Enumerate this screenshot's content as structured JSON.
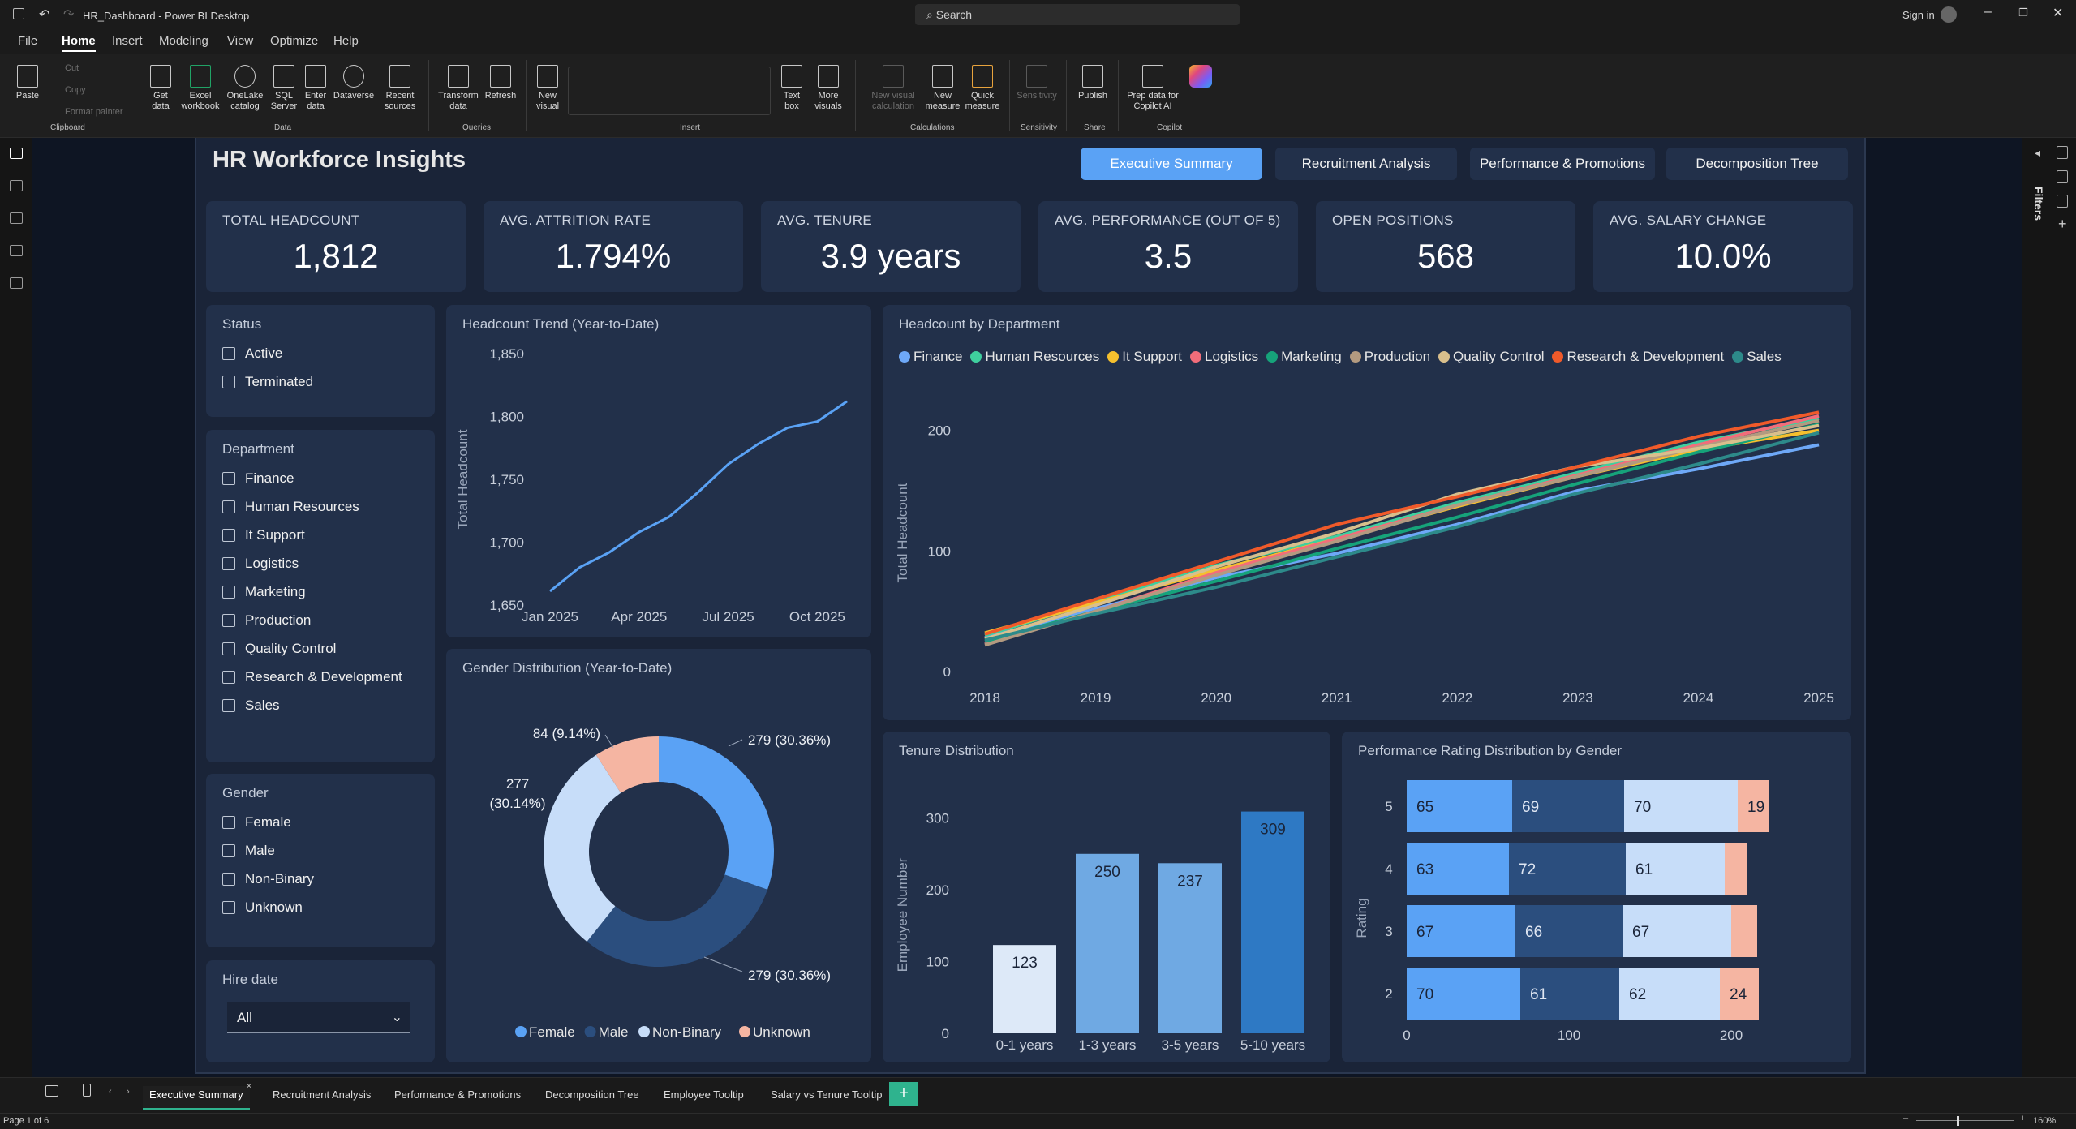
{
  "window": {
    "title": "HR_Dashboard - Power BI Desktop",
    "search_placeholder": "Search",
    "sign_in": "Sign in"
  },
  "menu": [
    "File",
    "Home",
    "Insert",
    "Modeling",
    "View",
    "Optimize",
    "Help"
  ],
  "ribbon": {
    "clipboard": {
      "paste": "Paste",
      "cut": "Cut",
      "copy": "Copy",
      "format_painter": "Format painter",
      "group": "Clipboard"
    },
    "data": {
      "get_data": "Get data",
      "excel": "Excel workbook",
      "onelake": "OneLake catalog",
      "sql": "SQL Server",
      "enter_data": "Enter data",
      "dataverse": "Dataverse",
      "recent": "Recent sources",
      "group": "Data"
    },
    "queries": {
      "transform": "Transform data",
      "refresh": "Refresh",
      "group": "Queries"
    },
    "insert": {
      "new_visual": "New visual",
      "text_box": "Text box",
      "more_visuals": "More visuals",
      "group": "Insert"
    },
    "calculations": {
      "new_visual_calc": "New visual calculation",
      "new_measure": "New measure",
      "quick_measure": "Quick measure",
      "group": "Calculations"
    },
    "sensitivity": {
      "label": "Sensitivity",
      "group": "Sensitivity"
    },
    "share": {
      "publish": "Publish",
      "group": "Share"
    },
    "copilot": {
      "prep": "Prep data for Copilot AI",
      "group": "Copilot"
    }
  },
  "report": {
    "title": "HR Workforce Insights",
    "nav": [
      "Executive Summary",
      "Recruitment Analysis",
      "Performance & Promotions",
      "Decomposition Tree"
    ],
    "kpis": [
      {
        "label": "TOTAL HEADCOUNT",
        "value": "1,812"
      },
      {
        "label": "AVG. ATTRITION RATE",
        "value": "1.794%"
      },
      {
        "label": "AVG. TENURE",
        "value": "3.9 years"
      },
      {
        "label": "AVG. PERFORMANCE (OUT OF 5)",
        "value": "3.5"
      },
      {
        "label": "OPEN POSITIONS",
        "value": "568"
      },
      {
        "label": "AVG. SALARY CHANGE",
        "value": "10.0%"
      }
    ],
    "slicers": {
      "status": {
        "title": "Status",
        "items": [
          "Active",
          "Terminated"
        ]
      },
      "department": {
        "title": "Department",
        "items": [
          "Finance",
          "Human Resources",
          "It Support",
          "Logistics",
          "Marketing",
          "Production",
          "Quality Control",
          "Research & Development",
          "Sales"
        ]
      },
      "gender": {
        "title": "Gender",
        "items": [
          "Female",
          "Male",
          "Non-Binary",
          "Unknown"
        ]
      },
      "hire_date": {
        "title": "Hire date",
        "value": "All"
      }
    }
  },
  "page_tabs": [
    "Executive Summary",
    "Recruitment Analysis",
    "Performance & Promotions",
    "Decomposition Tree",
    "Employee Tooltip",
    "Salary vs Tenure Tooltip"
  ],
  "status": {
    "page": "Page 1 of 6",
    "zoom": "160%"
  },
  "colors": {
    "accent": "#5aa2f5",
    "page_bg": "#1a2438",
    "card_bg": "#22304a"
  },
  "chart_data": [
    {
      "type": "line",
      "title": "Headcount Trend (Year-to-Date)",
      "ylabel": "Total Headcount",
      "x_ticks": [
        "Jan 2025",
        "Apr 2025",
        "Jul 2025",
        "Oct 2025"
      ],
      "ylim": [
        1650,
        1850
      ],
      "y_ticks": [
        "1,850",
        "1,800",
        "1,750",
        "1,700",
        "1,650"
      ],
      "x": [
        "Jan 2025",
        "Feb 2025",
        "Mar 2025",
        "Apr 2025",
        "May 2025",
        "Jun 2025",
        "Jul 2025",
        "Aug 2025",
        "Sep 2025",
        "Oct 2025",
        "Nov 2025"
      ],
      "values": [
        1661,
        1680,
        1692,
        1708,
        1720,
        1740,
        1762,
        1778,
        1791,
        1796,
        1812
      ],
      "color": "#5aa2f5"
    },
    {
      "type": "line",
      "title": "Headcount by Department",
      "ylabel": "Total Headcount",
      "x": [
        "2018",
        "2019",
        "2020",
        "2021",
        "2022",
        "2023",
        "2024",
        "2025"
      ],
      "ylim": [
        0,
        230
      ],
      "y_ticks": [
        "200",
        "100",
        "0"
      ],
      "series": [
        {
          "name": "Finance",
          "color": "#6ea8f7",
          "values": [
            28,
            52,
            78,
            98,
            122,
            150,
            168,
            188
          ]
        },
        {
          "name": "Human Resources",
          "color": "#3fcf9e",
          "values": [
            30,
            58,
            88,
            112,
            140,
            165,
            190,
            210
          ]
        },
        {
          "name": "It Support",
          "color": "#f5c02e",
          "values": [
            32,
            57,
            84,
            110,
            137,
            162,
            184,
            200
          ]
        },
        {
          "name": "Logistics",
          "color": "#f26d7a",
          "values": [
            23,
            50,
            82,
            110,
            138,
            163,
            188,
            212
          ]
        },
        {
          "name": "Marketing",
          "color": "#16a37a",
          "values": [
            25,
            50,
            75,
            102,
            128,
            156,
            182,
            205
          ]
        },
        {
          "name": "Production",
          "color": "#b39a80",
          "values": [
            22,
            50,
            80,
            108,
            138,
            162,
            186,
            208
          ]
        },
        {
          "name": "Quality Control",
          "color": "#d9bf8c",
          "values": [
            27,
            55,
            87,
            115,
            147,
            170,
            185,
            204
          ]
        },
        {
          "name": "Research & Development",
          "color": "#f05a2a",
          "values": [
            31,
            60,
            91,
            122,
            145,
            170,
            195,
            215
          ]
        },
        {
          "name": "Sales",
          "color": "#2d8a8a",
          "values": [
            26,
            48,
            70,
            95,
            120,
            148,
            172,
            198
          ]
        }
      ]
    },
    {
      "type": "pie",
      "title": "Gender Distribution (Year-to-Date)",
      "slices": [
        {
          "name": "Female",
          "value": 279,
          "label": "279 (30.36%)",
          "color": "#5aa2f5"
        },
        {
          "name": "Male",
          "value": 279,
          "label": "279 (30.36%)",
          "color": "#2b4e7e"
        },
        {
          "name": "Non-Binary",
          "value": 277,
          "label": "277 (30.14%)",
          "color": "#c7ddf9"
        },
        {
          "name": "Unknown",
          "value": 84,
          "label": "84 (9.14%)",
          "color": "#f5b5a2"
        }
      ]
    },
    {
      "type": "bar",
      "title": "Tenure Distribution",
      "ylabel": "Employee Number",
      "categories": [
        "0-1 years",
        "1-3 years",
        "3-5 years",
        "5-10 years"
      ],
      "values": [
        123,
        250,
        237,
        309
      ],
      "ylim": [
        0,
        330
      ],
      "y_ticks": [
        "300",
        "200",
        "100",
        "0"
      ],
      "colors": [
        "#dde9f8",
        "#6fa9e3",
        "#6fa9e3",
        "#2e79c4"
      ]
    },
    {
      "type": "bar",
      "orientation": "horizontal-stacked",
      "title": "Performance Rating Distribution by Gender",
      "ylabel": "Rating",
      "categories": [
        "5",
        "4",
        "3",
        "2"
      ],
      "xlim": [
        0,
        240
      ],
      "x_ticks": [
        "0",
        "100",
        "200"
      ],
      "series": [
        {
          "name": "Female",
          "color": "#5aa2f5",
          "values": [
            65,
            63,
            67,
            70
          ]
        },
        {
          "name": "Male",
          "color": "#2b4e7e",
          "values": [
            69,
            72,
            66,
            61
          ]
        },
        {
          "name": "Non-Binary",
          "color": "#c7ddf9",
          "values": [
            70,
            61,
            67,
            62
          ]
        },
        {
          "name": "Unknown",
          "color": "#f5b5a2",
          "values": [
            19,
            14,
            16,
            24
          ]
        }
      ],
      "labels": [
        [
          "65",
          "69",
          "70",
          "19"
        ],
        [
          "63",
          "72",
          "61",
          ""
        ],
        [
          "67",
          "66",
          "67",
          ""
        ],
        [
          "70",
          "61",
          "62",
          "24"
        ]
      ]
    }
  ]
}
